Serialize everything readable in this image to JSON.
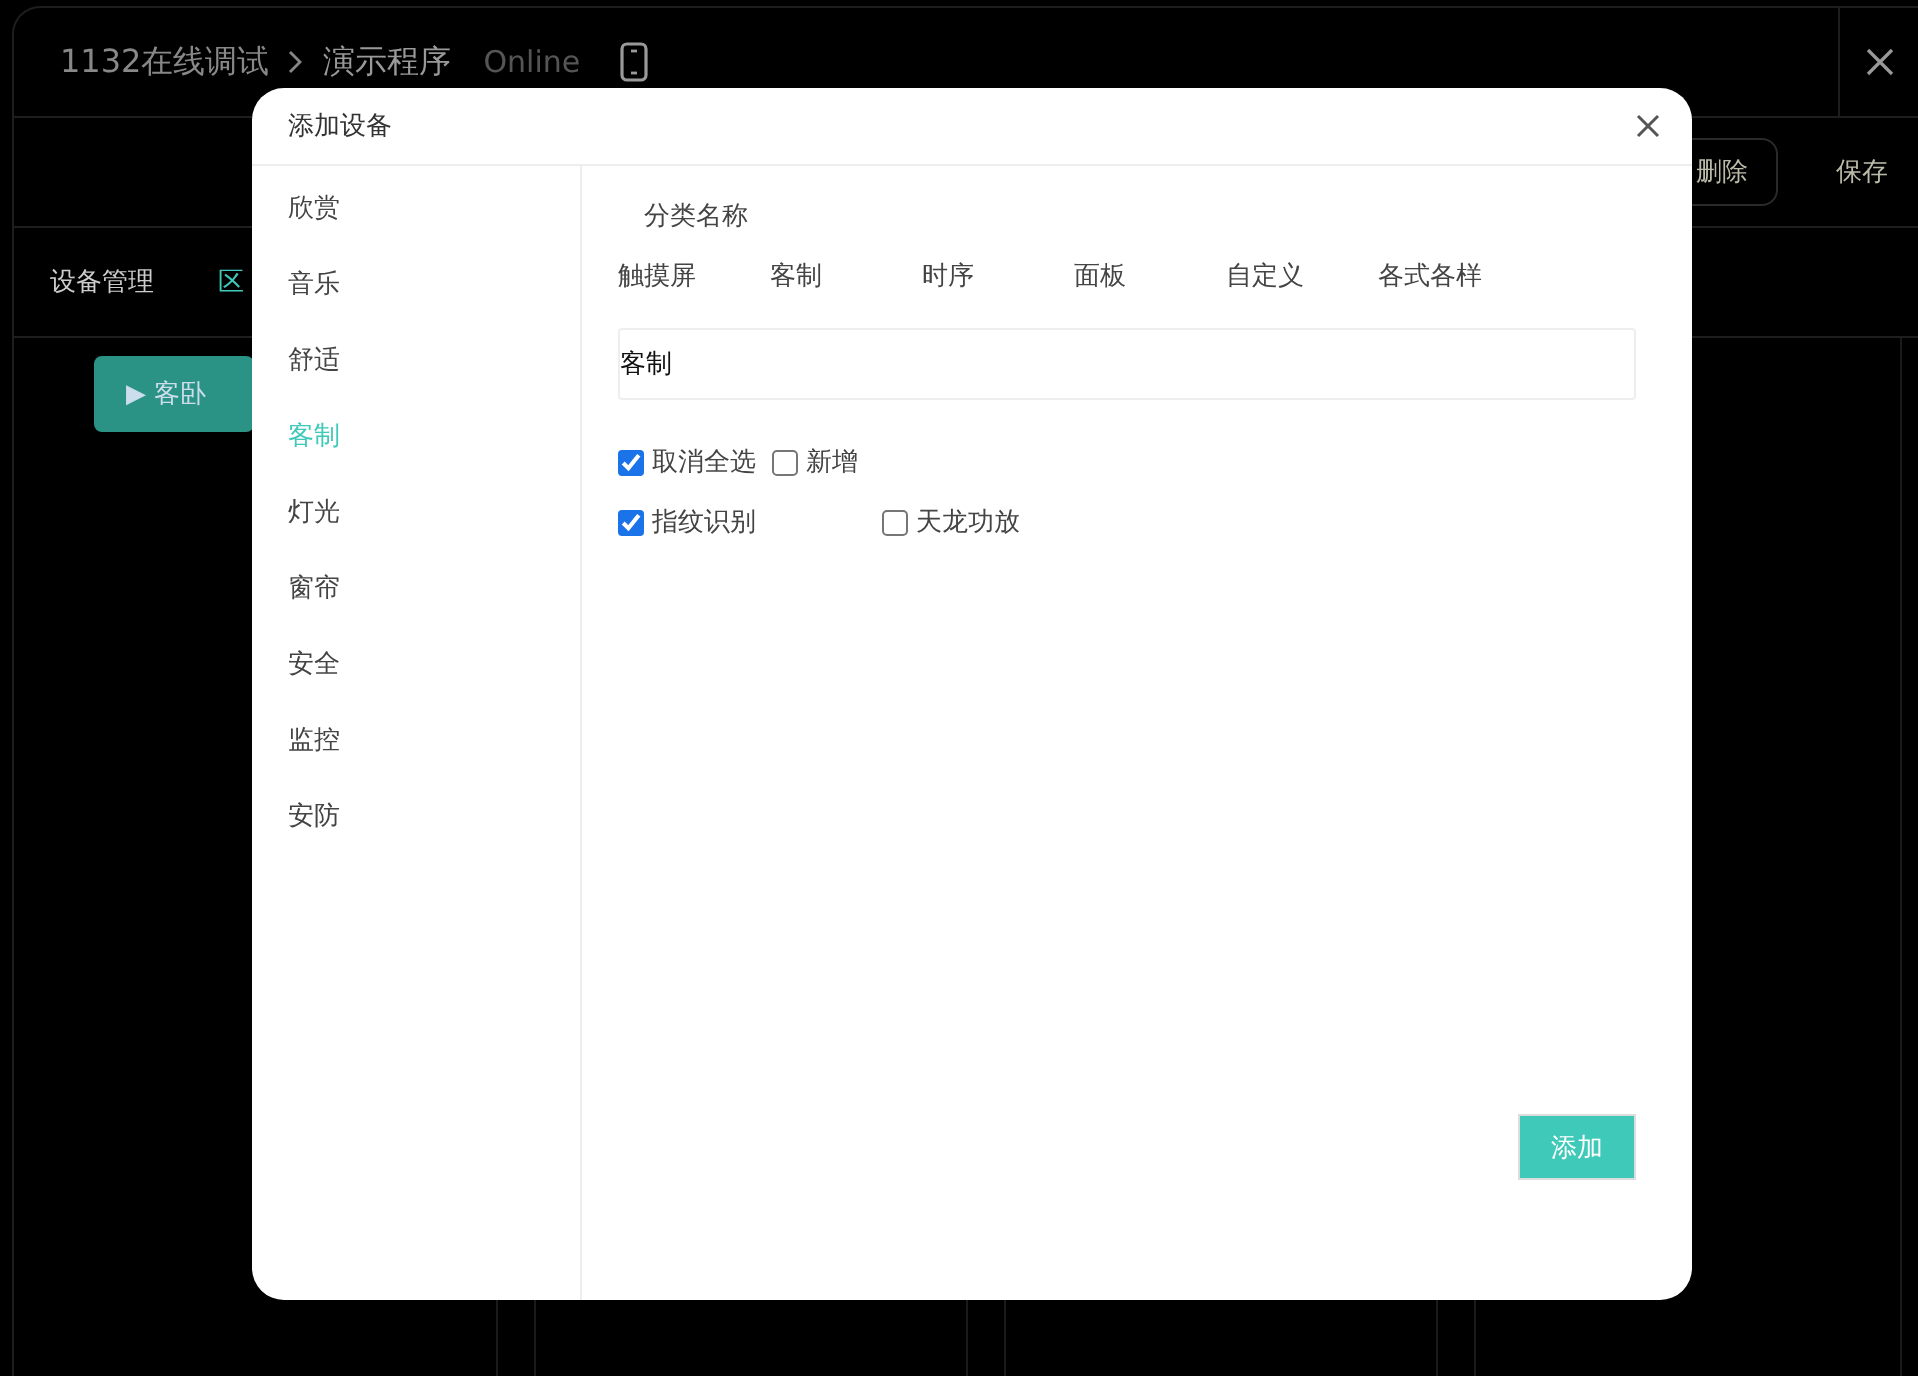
{
  "app": {
    "breadcrumb": "1132在线调试",
    "program": "演示程序",
    "status": "Online",
    "toolbar_buttons": [
      "删除",
      "保存"
    ],
    "tabs": [
      {
        "label": "设备管理",
        "selected": false
      },
      {
        "label": "区",
        "selected": true
      }
    ],
    "room_button": {
      "icon": "▶",
      "label": "客卧"
    }
  },
  "dialog": {
    "title": "添加设备",
    "sidebar": [
      {
        "label": "欣赏",
        "selected": false
      },
      {
        "label": "音乐",
        "selected": false
      },
      {
        "label": "舒适",
        "selected": false
      },
      {
        "label": "客制",
        "selected": true
      },
      {
        "label": "灯光",
        "selected": false
      },
      {
        "label": "窗帘",
        "selected": false
      },
      {
        "label": "安全",
        "selected": false
      },
      {
        "label": "监控",
        "selected": false
      },
      {
        "label": "安防",
        "selected": false
      }
    ],
    "category_label": "分类名称",
    "categories": [
      "触摸屏",
      "客制",
      "时序",
      "面板",
      "自定义",
      "各式各样"
    ],
    "name_field": {
      "value": "客制"
    },
    "select_controls": [
      {
        "label": "取消全选",
        "checked": true
      },
      {
        "label": "新增",
        "checked": false
      }
    ],
    "devices": [
      {
        "label": "指纹识别",
        "checked": true
      },
      {
        "label": "天龙功放",
        "checked": false
      }
    ],
    "add_button": "添加"
  }
}
